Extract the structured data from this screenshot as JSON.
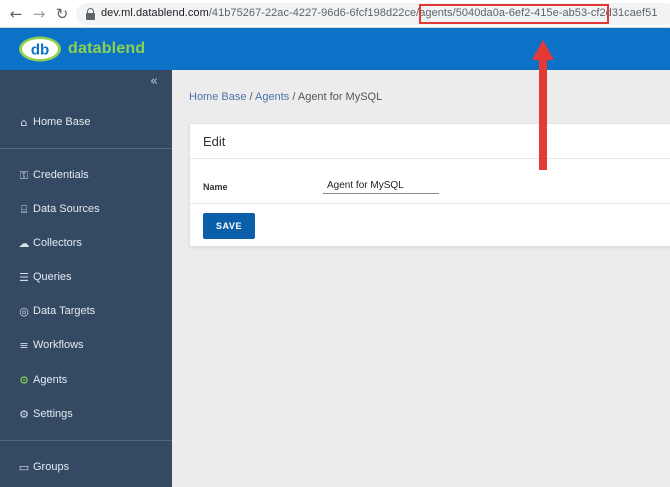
{
  "browser": {
    "back_icon": "←",
    "forward_icon": "→",
    "reload_icon": "↻",
    "url_prefix": "dev.ml.datablend.com",
    "url_path": "/41b75267-22ac-4227-96d6-6fcf198d22ce/agents/",
    "url_id": "5040da0a-6ef2-415e-ab53-cf2d31caef51"
  },
  "app": {
    "logo_mark": "db",
    "logo_text": "datablend",
    "brand_color": "#0b72c8",
    "accent_color": "#8fd14f"
  },
  "sidebar": {
    "collapse_icon": "«",
    "items": [
      {
        "label": "Home Base",
        "icon": "home-icon",
        "glyph": "⌂"
      },
      {
        "label": "Credentials",
        "icon": "lock-icon",
        "glyph": "⚿"
      },
      {
        "label": "Data Sources",
        "icon": "database-icon",
        "glyph": "⌸"
      },
      {
        "label": "Collectors",
        "icon": "cloud-download-icon",
        "glyph": "☁"
      },
      {
        "label": "Queries",
        "icon": "list-icon",
        "glyph": "☰"
      },
      {
        "label": "Data Targets",
        "icon": "target-icon",
        "glyph": "◎"
      },
      {
        "label": "Workflows",
        "icon": "layers-icon",
        "glyph": "≡"
      },
      {
        "label": "Agents",
        "icon": "agents-icon",
        "glyph": "⚙"
      },
      {
        "label": "Settings",
        "icon": "gear-icon",
        "glyph": "⚙"
      },
      {
        "label": "Groups",
        "icon": "folder-icon",
        "glyph": "▭"
      }
    ]
  },
  "breadcrumb": {
    "home": "Home Base",
    "sep1": " / ",
    "agents": "Agents",
    "sep2": " / ",
    "current": "Agent for MySQL"
  },
  "edit": {
    "title": "Edit",
    "name_label": "Name",
    "name_value": "Agent for MySQL",
    "save_label": "SAVE"
  }
}
